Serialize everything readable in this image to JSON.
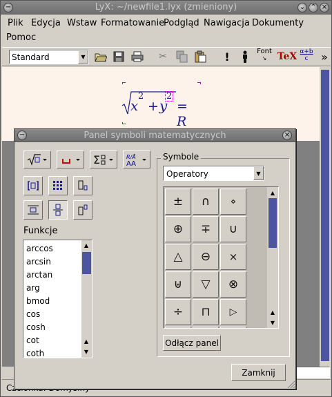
{
  "window": {
    "title": "LyX: ~/newfile1.lyx (zmieniony)"
  },
  "menu": [
    {
      "label": "Plik",
      "accel": "P"
    },
    {
      "label": "Edycja",
      "accel": "E"
    },
    {
      "label": "Wstaw",
      "accel": "W"
    },
    {
      "label": "Formatowanie",
      "accel": "F"
    },
    {
      "label": "Podgląd",
      "accel": "d"
    },
    {
      "label": "Nawigacja",
      "accel": "N"
    },
    {
      "label": "Dokumenty",
      "accel": "D"
    },
    {
      "label": "Pomoc",
      "accel": "P"
    }
  ],
  "toolbar": {
    "style_value": "Standard",
    "font_label": "Font",
    "tex_label": "TeX",
    "more_label": "»",
    "mathtool_label_top": "α+b",
    "mathtool_label_bottom": "c"
  },
  "document": {
    "formula_x": "x",
    "formula_x_exp": "2",
    "formula_plus": "+",
    "formula_y": "y",
    "formula_y_exp": "2",
    "formula_eq": "= R"
  },
  "status": {
    "text": "Czcionka: Domyślny"
  },
  "panel": {
    "title": "Panel symboli matematycznych",
    "functions_label": "Funkcje",
    "functions": [
      "arccos",
      "arcsin",
      "arctan",
      "arg",
      "bmod",
      "cos",
      "cosh",
      "cot",
      "coth"
    ],
    "symbols_label": "Symbole",
    "category_value": "Operatory",
    "symbols": [
      "±",
      "∩",
      "⋄",
      "⊕",
      "∓",
      "∪",
      "△",
      "⊖",
      "×",
      "⊎",
      "▽",
      "⊗",
      "÷",
      "⊓",
      "▷"
    ],
    "detach_label": "Odłącz panel",
    "close_label": "Zamknij",
    "colors": {
      "selected_func": "#3d4a8f",
      "scroll_thumb": "#4d55a0",
      "frame": "#c800c8"
    }
  }
}
